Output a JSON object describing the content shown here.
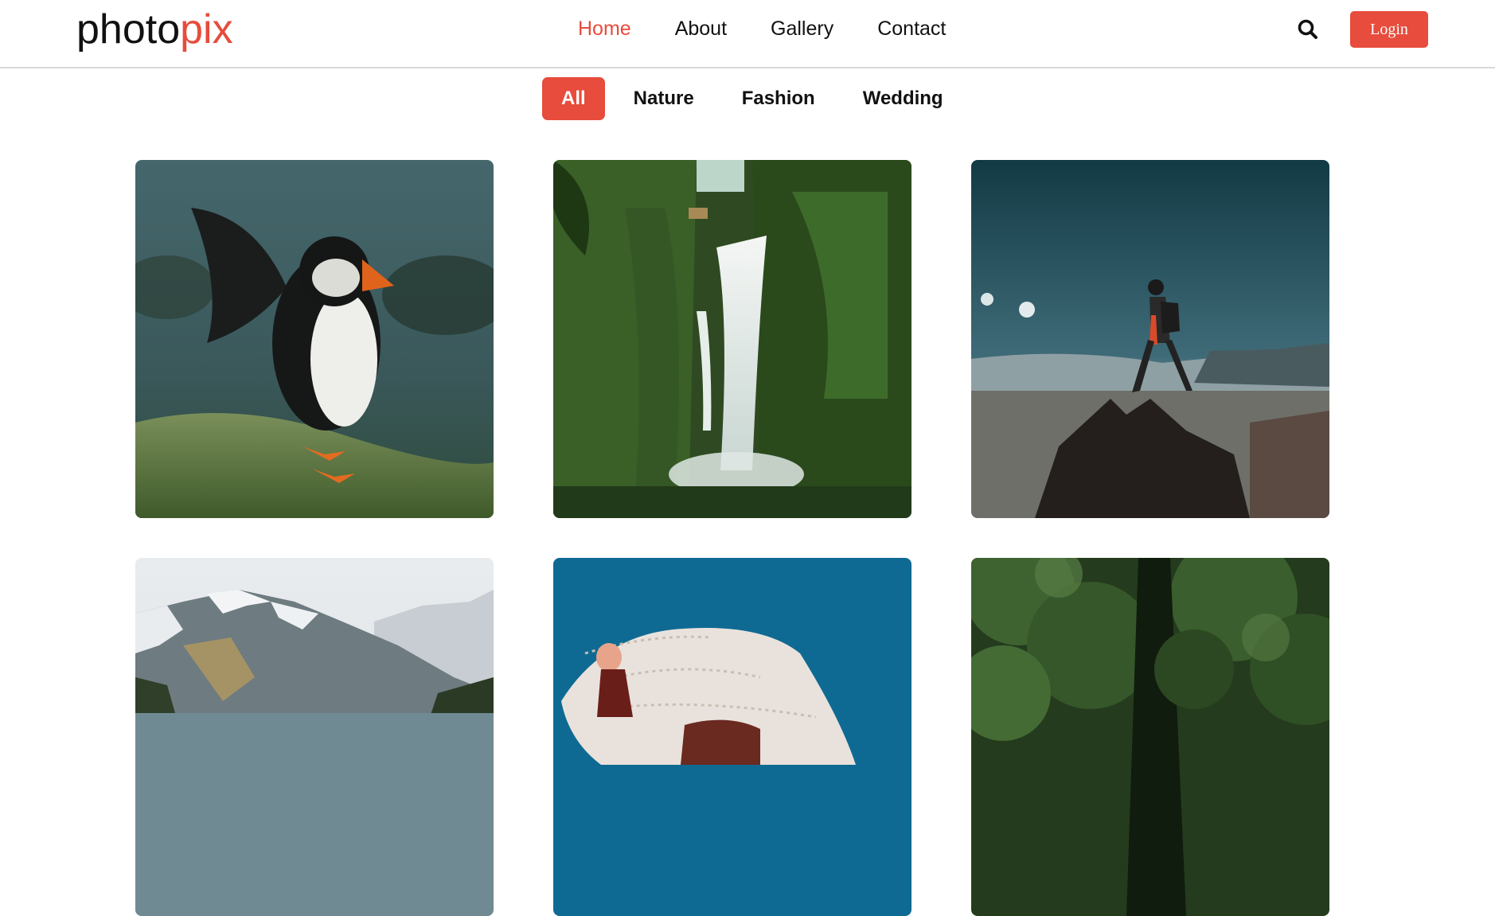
{
  "brand": {
    "prefix": "photo",
    "accent": "pix"
  },
  "nav": {
    "items": [
      {
        "label": "Home",
        "active": true
      },
      {
        "label": "About",
        "active": false
      },
      {
        "label": "Gallery",
        "active": false
      },
      {
        "label": "Contact",
        "active": false
      }
    ]
  },
  "header": {
    "search_icon": "search-icon",
    "login_label": "Login"
  },
  "filters": {
    "items": [
      {
        "label": "All",
        "active": true
      },
      {
        "label": "Nature",
        "active": false
      },
      {
        "label": "Fashion",
        "active": false
      },
      {
        "label": "Wedding",
        "active": false
      }
    ]
  },
  "gallery": {
    "photos": [
      {
        "subject": "puffin on grass"
      },
      {
        "subject": "jungle waterfall"
      },
      {
        "subject": "hiker on mountain peak"
      },
      {
        "subject": "snowy mountains by lake"
      },
      {
        "subject": "person under lace veil"
      },
      {
        "subject": "green forest foliage"
      }
    ]
  },
  "colors": {
    "accent": "#e74c3c",
    "text": "#111111",
    "divider": "#d9d9d9"
  }
}
